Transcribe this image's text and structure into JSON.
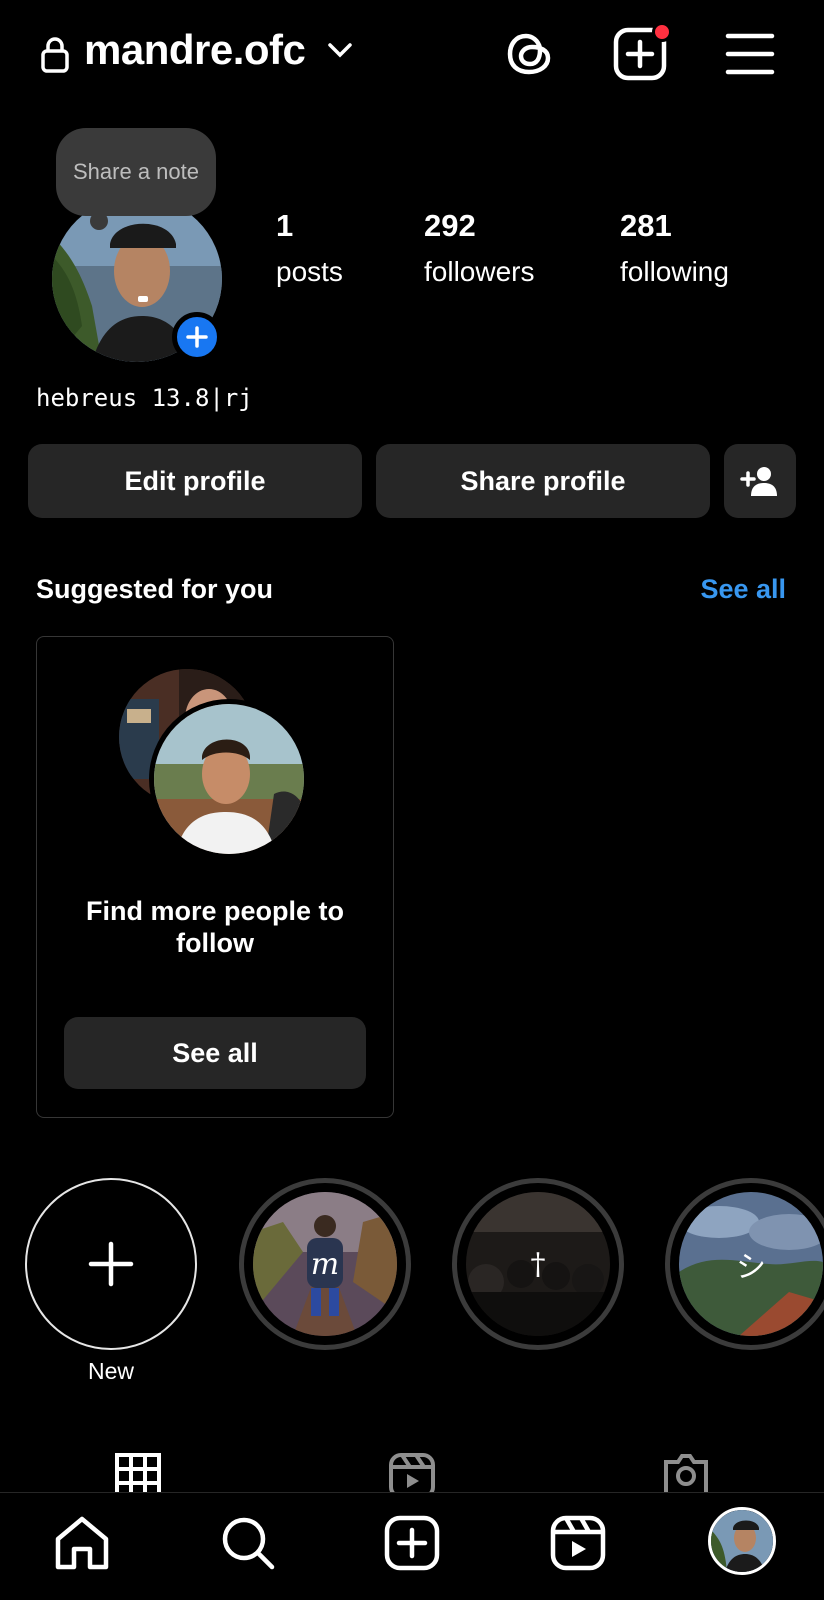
{
  "header": {
    "username": "mandre.ofc",
    "lock_icon": "lock-icon",
    "switcher_icon": "chevron-down-icon",
    "threads_icon": "threads-icon",
    "create_icon": "plus-square-icon",
    "menu_icon": "hamburger-menu-icon",
    "notification_color": "#ff3040"
  },
  "profile": {
    "note_bubble": "Share a note",
    "stats": [
      {
        "value": "1",
        "label": "posts"
      },
      {
        "value": "292",
        "label": "followers"
      },
      {
        "value": "281",
        "label": "following"
      }
    ],
    "bio": "hebreus 13.8|rj",
    "buttons": {
      "edit": "Edit profile",
      "share": "Share profile"
    },
    "accent": "#1877f2"
  },
  "suggested": {
    "title": "Suggested for you",
    "see_all": "See all",
    "see_all_color": "#3897f0",
    "card": {
      "text": "Find more people to follow",
      "button": "See all"
    }
  },
  "highlights": {
    "new_label": "New",
    "items": [
      {
        "glyph": "m"
      },
      {
        "glyph": "†"
      },
      {
        "glyph": "シ"
      }
    ]
  },
  "tabs": [
    "grid-icon",
    "reels-icon",
    "tagged-icon"
  ],
  "bottom_nav": [
    "home-icon",
    "search-icon",
    "create-icon",
    "reels-icon",
    "profile-avatar"
  ]
}
